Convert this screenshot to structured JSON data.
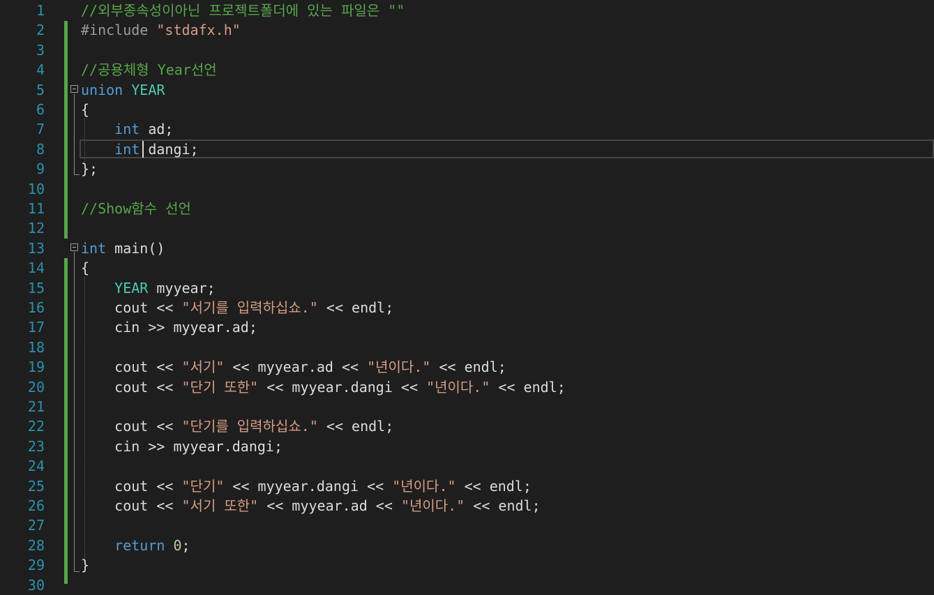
{
  "editor": {
    "colors": {
      "background": "#1e1e1e",
      "line_number": "#2b91af",
      "change_bar": "#57a64a",
      "comment": "#57a64a",
      "keyword": "#569cd6",
      "type": "#4ec9b0",
      "string": "#d69d85",
      "number": "#b5cea8",
      "preprocessor": "#9b9b9b",
      "plain": "#dcdcdc"
    },
    "line_numbers": [
      "1",
      "2",
      "3",
      "4",
      "5",
      "6",
      "7",
      "8",
      "9",
      "10",
      "11",
      "12",
      "13",
      "14",
      "15",
      "16",
      "17",
      "18",
      "19",
      "20",
      "21",
      "22",
      "23",
      "24",
      "25",
      "26",
      "27",
      "28",
      "29",
      "30"
    ],
    "lines": [
      [
        {
          "t": "//외부종속성이아닌 프로젝트폴더에 있는 파일은 \"\"",
          "k": "comment"
        }
      ],
      [
        {
          "t": "#include ",
          "k": "pre"
        },
        {
          "t": "\"stdafx.h\"",
          "k": "string"
        }
      ],
      [],
      [
        {
          "t": "//공용체형 Year선언",
          "k": "comment"
        }
      ],
      [
        {
          "t": "union",
          "k": "keyword"
        },
        {
          "t": " ",
          "k": "plain"
        },
        {
          "t": "YEAR",
          "k": "type"
        }
      ],
      [
        {
          "t": "{",
          "k": "plain"
        }
      ],
      [
        {
          "t": "    ",
          "k": "plain"
        },
        {
          "t": "int",
          "k": "keyword"
        },
        {
          "t": " ad;",
          "k": "plain"
        }
      ],
      [
        {
          "t": "    ",
          "k": "plain"
        },
        {
          "t": "int",
          "k": "keyword"
        },
        {
          "t": " dangi;",
          "k": "plain"
        }
      ],
      [
        {
          "t": "};",
          "k": "plain"
        }
      ],
      [],
      [
        {
          "t": "//Show함수 선언",
          "k": "comment"
        }
      ],
      [],
      [
        {
          "t": "int",
          "k": "keyword"
        },
        {
          "t": " main()",
          "k": "plain"
        }
      ],
      [
        {
          "t": "{",
          "k": "plain"
        }
      ],
      [
        {
          "t": "    ",
          "k": "plain"
        },
        {
          "t": "YEAR",
          "k": "type"
        },
        {
          "t": " myyear;",
          "k": "plain"
        }
      ],
      [
        {
          "t": "    cout << ",
          "k": "plain"
        },
        {
          "t": "\"서기를 입력하십쇼.\"",
          "k": "string"
        },
        {
          "t": " << endl;",
          "k": "plain"
        }
      ],
      [
        {
          "t": "    cin >> myyear.ad;",
          "k": "plain"
        }
      ],
      [],
      [
        {
          "t": "    cout << ",
          "k": "plain"
        },
        {
          "t": "\"서기\"",
          "k": "string"
        },
        {
          "t": " << myyear.ad << ",
          "k": "plain"
        },
        {
          "t": "\"년이다.\"",
          "k": "string"
        },
        {
          "t": " << endl;",
          "k": "plain"
        }
      ],
      [
        {
          "t": "    cout << ",
          "k": "plain"
        },
        {
          "t": "\"단기 또한\"",
          "k": "string"
        },
        {
          "t": " << myyear.dangi << ",
          "k": "plain"
        },
        {
          "t": "\"년이다.\"",
          "k": "string"
        },
        {
          "t": " << endl;",
          "k": "plain"
        }
      ],
      [],
      [
        {
          "t": "    cout << ",
          "k": "plain"
        },
        {
          "t": "\"단기를 입력하십쇼.\"",
          "k": "string"
        },
        {
          "t": " << endl;",
          "k": "plain"
        }
      ],
      [
        {
          "t": "    cin >> myyear.dangi;",
          "k": "plain"
        }
      ],
      [],
      [
        {
          "t": "    cout << ",
          "k": "plain"
        },
        {
          "t": "\"단기\"",
          "k": "string"
        },
        {
          "t": " << myyear.dangi << ",
          "k": "plain"
        },
        {
          "t": "\"년이다.\"",
          "k": "string"
        },
        {
          "t": " << endl;",
          "k": "plain"
        }
      ],
      [
        {
          "t": "    cout << ",
          "k": "plain"
        },
        {
          "t": "\"서기 또한\"",
          "k": "string"
        },
        {
          "t": " << myyear.ad << ",
          "k": "plain"
        },
        {
          "t": "\"년이다.\"",
          "k": "string"
        },
        {
          "t": " << endl;",
          "k": "plain"
        }
      ],
      [],
      [
        {
          "t": "    ",
          "k": "plain"
        },
        {
          "t": "return",
          "k": "keyword"
        },
        {
          "t": " ",
          "k": "plain"
        },
        {
          "t": "0",
          "k": "number"
        },
        {
          "t": ";",
          "k": "plain"
        }
      ],
      [
        {
          "t": "}",
          "k": "plain"
        }
      ],
      []
    ],
    "current_line": 8,
    "fold_markers": [
      5,
      13
    ]
  }
}
